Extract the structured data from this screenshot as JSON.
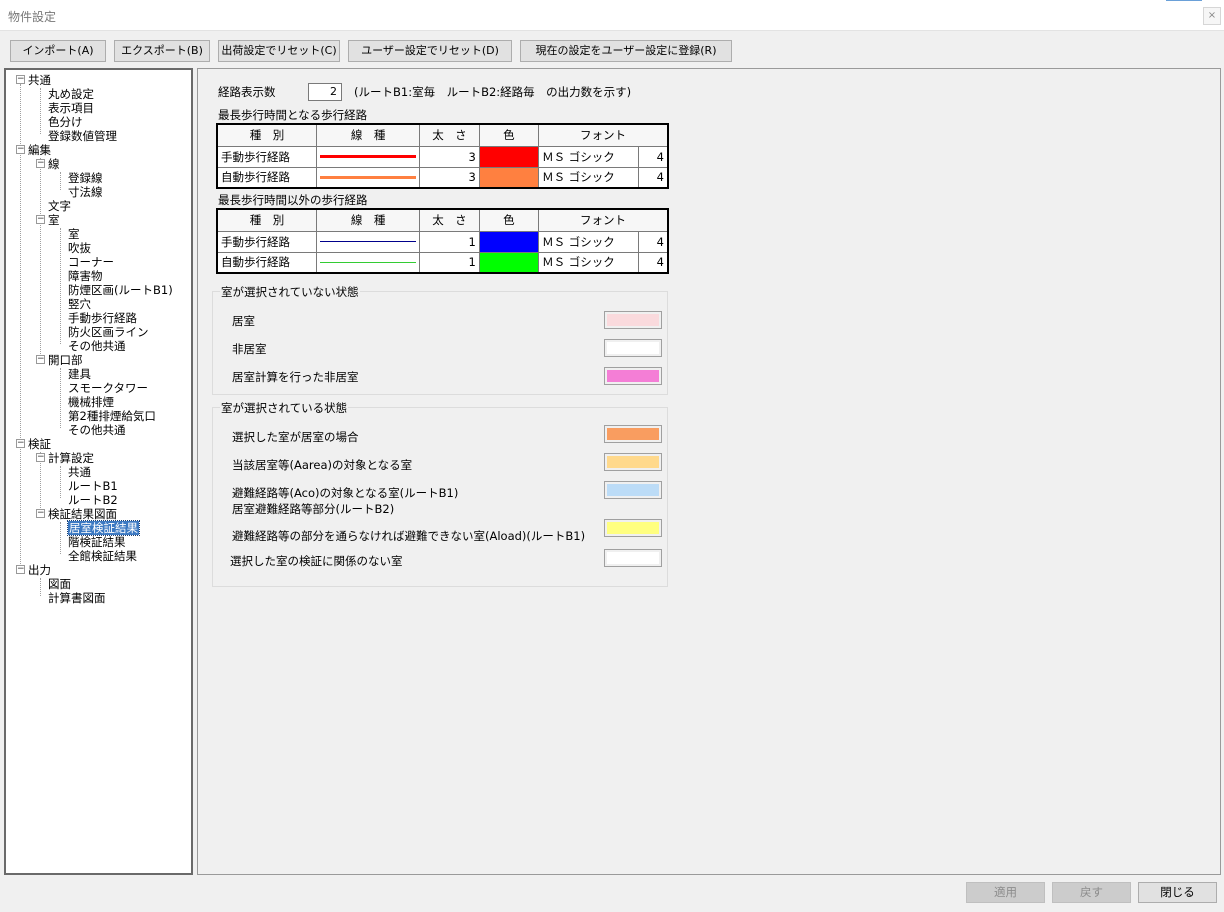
{
  "window": {
    "title": "物件設定",
    "close_glyph": "×"
  },
  "toolbar": {
    "import": "インポート(A)",
    "export": "エクスポート(B)",
    "reset_shipping": "出荷設定でリセット(C)",
    "reset_user": "ユーザー設定でリセット(D)",
    "register_user": "現在の設定をユーザー設定に登録(R)"
  },
  "tree": {
    "n0": "共通",
    "n1": "丸め設定",
    "n2": "表示項目",
    "n3": "色分け",
    "n4": "登録数値管理",
    "n5": "編集",
    "n6": "線",
    "n7": "登録線",
    "n8": "寸法線",
    "n9": "文字",
    "n10": "室",
    "n11": "室",
    "n12": "吹抜",
    "n13": "コーナー",
    "n14": "障害物",
    "n15": "防煙区画(ルートB1)",
    "n16": "竪穴",
    "n17": "手動歩行経路",
    "n18": "防火区画ライン",
    "n19": "その他共通",
    "n20": "開口部",
    "n21": "建具",
    "n22": "スモークタワー",
    "n23": "機械排煙",
    "n24": "第2種排煙給気口",
    "n25": "その他共通",
    "n26": "検証",
    "n27": "計算設定",
    "n28": "共通",
    "n29": "ルートB1",
    "n30": "ルートB2",
    "n31": "検証結果図面",
    "n32": "居室検証結果",
    "n33": "階検証結果",
    "n34": "全館検証結果",
    "n35": "出力",
    "n36": "図面",
    "n37": "計算書図面",
    "toggle": "−"
  },
  "main": {
    "route_count_label": "経路表示数",
    "route_count_value": "2",
    "route_count_note": "(ルートB1:室毎　ルートB2:経路毎　の出力数を示す)",
    "table_headers": {
      "type": "種　別",
      "line": "線　種",
      "width": "太　さ",
      "color": "色",
      "font": "フォント"
    },
    "longest_title": "最長歩行時間となる歩行経路",
    "longest_rows": [
      {
        "type": "手動歩行経路",
        "width": "3",
        "font": "ＭＳ ゴシック",
        "size": "4"
      },
      {
        "type": "自動歩行経路",
        "width": "3",
        "font": "ＭＳ ゴシック",
        "size": "4"
      }
    ],
    "other_title": "最長歩行時間以外の歩行経路",
    "other_rows": [
      {
        "type": "手動歩行経路",
        "width": "1",
        "font": "ＭＳ ゴシック",
        "size": "4"
      },
      {
        "type": "自動歩行経路",
        "width": "1",
        "font": "ＭＳ ゴシック",
        "size": "4"
      }
    ],
    "unselected_title": "室が選択されていない状態",
    "unselected": {
      "living": "居室",
      "non_living": "非居室",
      "calc_non_living": "居室計算を行った非居室"
    },
    "selected_title": "室が選択されている状態",
    "selected": {
      "s1": "選択した室が居室の場合",
      "s2": "当該居室等(Aarea)の対象となる室",
      "s3a": "避難経路等(Aco)の対象となる室(ルートB1)",
      "s3b": "居室避難経路等部分(ルートB2)",
      "s4": "避難経路等の部分を通らなければ避難できない室(Aload)(ルートB1)",
      "s5": "選択した室の検証に関係のない室"
    }
  },
  "footer": {
    "apply": "適用",
    "back": "戻す",
    "close": "閉じる"
  },
  "colors": {
    "longest_manual": "#ff0000",
    "longest_auto": "#ff8040",
    "other_manual": "#0000ff",
    "other_auto": "#00ff00",
    "other_manual_line": "#00008b",
    "other_auto_line": "#33cc33",
    "unsel_living": "#fadadd",
    "unsel_non_living": "#ffffff",
    "unsel_calc": "#f47ed6",
    "sel_living": "#f99d60",
    "sel_aarea": "#ffd98c",
    "sel_aco": "#bcdcf7",
    "sel_aload": "#ffff80",
    "sel_unrelated": "#ffffff",
    "tree_selection": "#3c79c2"
  }
}
